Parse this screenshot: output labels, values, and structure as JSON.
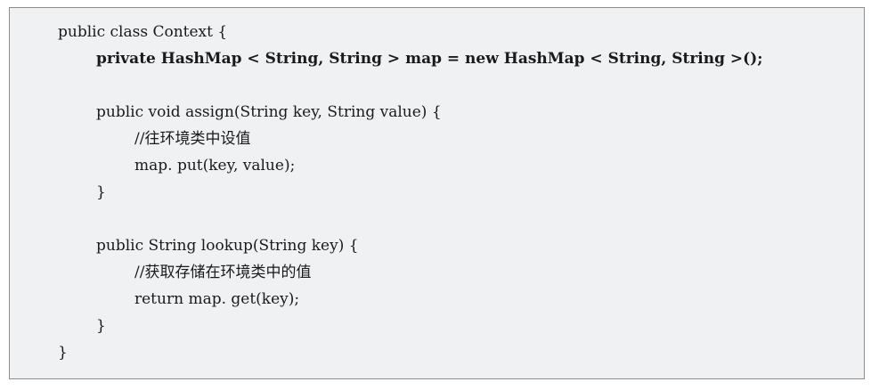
{
  "code_lines": {
    "l1": "public class Context {",
    "l2": "private HashMap < String, String > map = new HashMap < String, String >();",
    "l4": "public void assign(String key, String value) {",
    "l5": "//往环境类中设值",
    "l6": "map. put(key, value);",
    "l7": "}",
    "l9": "public String lookup(String key) {",
    "l10": "//获取存储在环境类中的值",
    "l11": "return map. get(key);",
    "l12": "}",
    "l13": "}"
  }
}
